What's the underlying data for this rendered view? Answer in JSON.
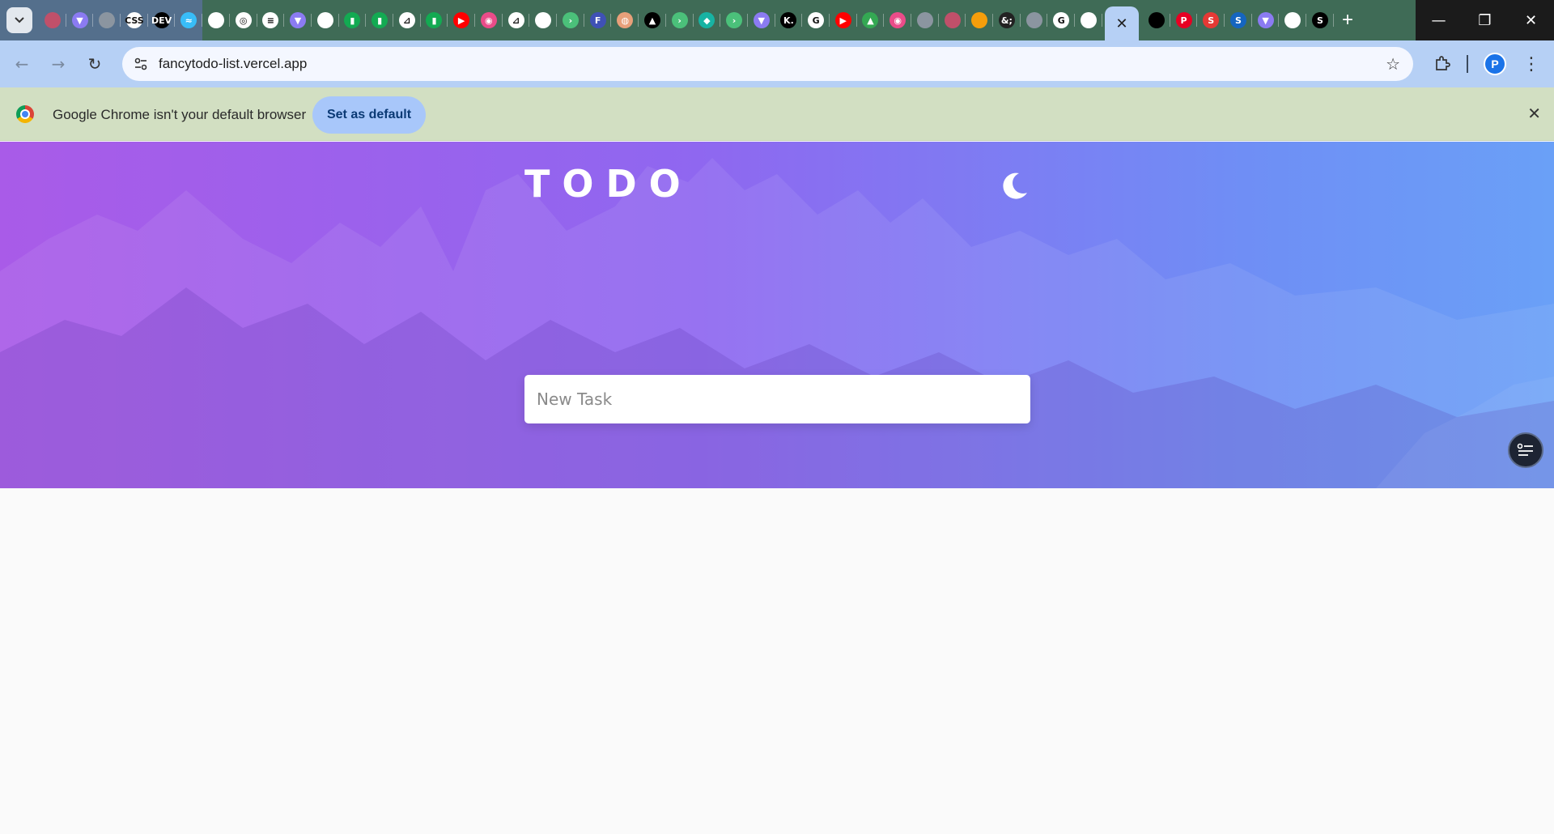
{
  "browser": {
    "url": "fancytodo-list.vercel.app",
    "profile_initial": "P",
    "window_controls": {
      "minimize": "—",
      "restore": "❐",
      "close": "✕"
    },
    "active_tab_close": "✕",
    "new_tab": "+"
  },
  "tabs_left": [
    {
      "icon": "generic-icon",
      "label": "",
      "color": "#c0506a"
    },
    {
      "icon": "vite-icon",
      "label": "▼",
      "color": "#8b7bf2"
    },
    {
      "icon": "globe-icon",
      "label": "",
      "color": "#8b95a0"
    },
    {
      "icon": "css-icon",
      "label": "CSS",
      "color": "#ffffff"
    },
    {
      "icon": "dev-icon",
      "label": "DEV",
      "color": "#000000"
    },
    {
      "icon": "tailwind-icon",
      "label": "≈",
      "color": "#38bdf8"
    },
    {
      "icon": "github-icon",
      "label": "",
      "color": "#ffffff"
    },
    {
      "icon": "target-icon",
      "label": "◎",
      "color": "#ffffff"
    },
    {
      "icon": "doc-icon",
      "label": "≡",
      "color": "#ffffff"
    },
    {
      "icon": "vite-icon",
      "label": "▼",
      "color": "#8b7bf2"
    },
    {
      "icon": "github-icon",
      "label": "",
      "color": "#ffffff"
    },
    {
      "icon": "mongodb-icon",
      "label": "▮",
      "color": "#13aa52"
    },
    {
      "icon": "mongodb-icon",
      "label": "▮",
      "color": "#13aa52"
    },
    {
      "icon": "link-icon",
      "label": "⊿",
      "color": "#ffffff"
    },
    {
      "icon": "mongodb-icon",
      "label": "▮",
      "color": "#13aa52"
    },
    {
      "icon": "youtube-icon",
      "label": "▶",
      "color": "#ff0000"
    },
    {
      "icon": "dribbble-icon",
      "label": "◉",
      "color": "#ea4c89"
    },
    {
      "icon": "link-icon",
      "label": "⊿",
      "color": "#ffffff"
    },
    {
      "icon": "github-icon",
      "label": "",
      "color": "#ffffff"
    },
    {
      "icon": "arrow-icon",
      "label": "›",
      "color": "#4bc07a"
    },
    {
      "icon": "forms-icon",
      "label": "F",
      "color": "#3f51b5"
    },
    {
      "icon": "donut-icon",
      "label": "◍",
      "color": "#e8a07a"
    },
    {
      "icon": "triangle-icon",
      "label": "▲",
      "color": "#000000"
    },
    {
      "icon": "arrow-icon",
      "label": "›",
      "color": "#4bc07a"
    },
    {
      "icon": "diamond-icon",
      "label": "◆",
      "color": "#17b3a3"
    },
    {
      "icon": "arrow-icon",
      "label": "›",
      "color": "#4bc07a"
    },
    {
      "icon": "vite-icon",
      "label": "▼",
      "color": "#8b7bf2"
    },
    {
      "icon": "k-icon",
      "label": "K.",
      "color": "#000000"
    },
    {
      "icon": "google-icon",
      "label": "G",
      "color": "#ffffff"
    },
    {
      "icon": "youtube-icon",
      "label": "▶",
      "color": "#ff0000"
    },
    {
      "icon": "drive-icon",
      "label": "▲",
      "color": "#34a853"
    },
    {
      "icon": "dribbble-icon",
      "label": "◉",
      "color": "#ea4c89"
    },
    {
      "icon": "globe-icon",
      "label": "",
      "color": "#8b95a0"
    },
    {
      "icon": "generic-icon",
      "label": "",
      "color": "#c0506a"
    },
    {
      "icon": "gradient-icon",
      "label": "",
      "color": "#f59e0b"
    },
    {
      "icon": "ampersand-icon",
      "label": "&;",
      "color": "#222222"
    },
    {
      "icon": "globe-icon",
      "label": "",
      "color": "#8b95a0"
    },
    {
      "icon": "google-icon",
      "label": "G",
      "color": "#ffffff"
    },
    {
      "icon": "github-icon",
      "label": "",
      "color": "#ffffff"
    }
  ],
  "tabs_right": [
    {
      "icon": "terminal-icon",
      "label": "",
      "color": "#000000"
    },
    {
      "icon": "pinterest-icon",
      "label": "P",
      "color": "#e60023"
    },
    {
      "icon": "s-icon",
      "label": "S",
      "color": "#e53935"
    },
    {
      "icon": "s-icon",
      "label": "S",
      "color": "#1565c0"
    },
    {
      "icon": "vite-icon",
      "label": "▼",
      "color": "#8b7bf2"
    },
    {
      "icon": "github-icon",
      "label": "",
      "color": "#ffffff"
    },
    {
      "icon": "s-icon",
      "label": "S",
      "color": "#000000"
    }
  ],
  "infobar": {
    "message": "Google Chrome isn't your default browser",
    "button": "Set as default",
    "close": "✕"
  },
  "app": {
    "title": "TODO",
    "input_placeholder": "New Task",
    "input_value": ""
  },
  "colors": {
    "hero_gradient_start": "#a95be8",
    "hero_gradient_end": "#6aa0f7",
    "infobar_bg": "#d2dfc2",
    "toolbar_bg": "#b6d0f5",
    "tabstrip_bg": "#3f6b56"
  }
}
